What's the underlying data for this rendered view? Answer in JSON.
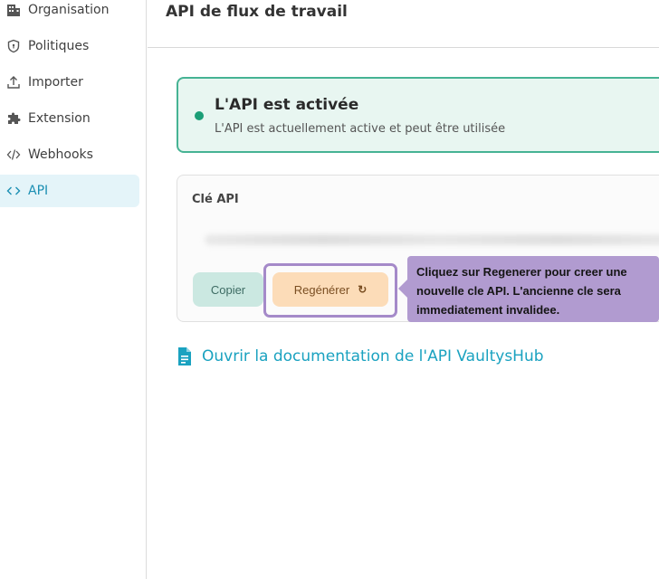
{
  "sidebar": {
    "items": [
      {
        "label": "Organisation",
        "icon": "building-icon"
      },
      {
        "label": "Politiques",
        "icon": "shield-icon"
      },
      {
        "label": "Importer",
        "icon": "upload-icon"
      },
      {
        "label": "Extension",
        "icon": "puzzle-icon"
      },
      {
        "label": "Webhooks",
        "icon": "code-slash-icon"
      },
      {
        "label": "API",
        "icon": "code-icon",
        "active": true
      }
    ]
  },
  "header": {
    "title": "API de flux de travail"
  },
  "status": {
    "title": "L'API est activée",
    "subtitle": "L'API est actuellement active et peut être utilisée",
    "color": "#1b9e77"
  },
  "api_key": {
    "label": "Clé API",
    "copy_label": "Copier",
    "regenerate_label": "Regénérer"
  },
  "tooltip": {
    "text": "Cliquez sur Regenerer pour creer une nouvelle cle API. L'ancienne cle sera immediatement invalidee."
  },
  "docs": {
    "link_label": "Ouvrir la documentation de l'API VaultysHub",
    "color": "#1aa2c0"
  },
  "colors": {
    "accent": "#1b8fb3",
    "tooltip_bg": "#b19bd0",
    "regen_bg": "#fcdcb8",
    "copy_bg": "#cbe8e1"
  }
}
